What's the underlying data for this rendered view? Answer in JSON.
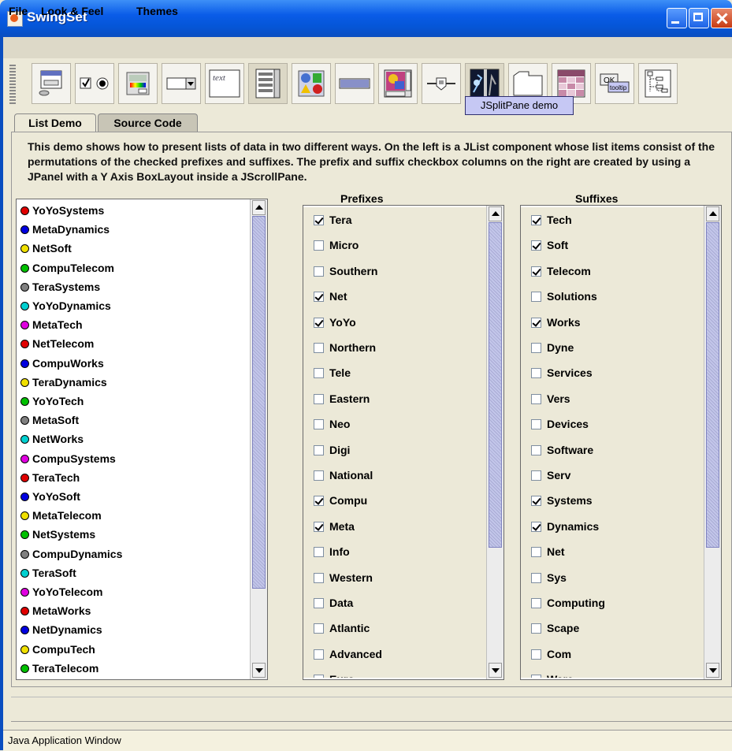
{
  "window": {
    "title": "SwingSet",
    "status_text": "Java Application Window"
  },
  "menubar": {
    "items": [
      {
        "label": "File"
      },
      {
        "label": "Look & Feel"
      },
      {
        "label": "Themes"
      }
    ]
  },
  "toolbar": {
    "buttons": [
      {
        "icon": "internal-frame-icon"
      },
      {
        "icon": "checkbox-radio-icon"
      },
      {
        "icon": "color-chooser-icon"
      },
      {
        "icon": "combobox-icon"
      },
      {
        "icon": "editor-pane-icon",
        "text": "text"
      },
      {
        "icon": "list-icon"
      },
      {
        "icon": "option-pane-icon"
      },
      {
        "icon": "progress-bar-icon"
      },
      {
        "icon": "scroll-pane-icon"
      },
      {
        "icon": "slider-icon"
      },
      {
        "icon": "split-pane-icon"
      },
      {
        "icon": "tabbed-pane-icon"
      },
      {
        "icon": "table-icon"
      },
      {
        "icon": "tooltip-icon",
        "text_ok": "OK",
        "text_tip": "tooltip"
      },
      {
        "icon": "tree-icon"
      }
    ],
    "tooltip": "JSplitPane demo"
  },
  "tabs": [
    {
      "label": "List Demo"
    },
    {
      "label": "Source Code"
    }
  ],
  "description": "This demo shows how to present lists of data in two different ways. On the left is a JList component whose list items consist of the permutations of the checked prefixes and suffixes. The prefix and suffix checkbox columns on the right are created by using a JPanel with a Y Axis BoxLayout inside a JScrollPane.",
  "prefixes_header": "Prefixes",
  "suffixes_header": "Suffixes",
  "list": [
    {
      "label": "YoYoSystems",
      "color": "#e00000"
    },
    {
      "label": "MetaDynamics",
      "color": "#0000e0"
    },
    {
      "label": "NetSoft",
      "color": "#f0e000"
    },
    {
      "label": "CompuTelecom",
      "color": "#00c000"
    },
    {
      "label": "TeraSystems",
      "color": "#808080"
    },
    {
      "label": "YoYoDynamics",
      "color": "#00d0d0"
    },
    {
      "label": "MetaTech",
      "color": "#e000e0"
    },
    {
      "label": "NetTelecom",
      "color": "#e00000"
    },
    {
      "label": "CompuWorks",
      "color": "#0000e0"
    },
    {
      "label": "TeraDynamics",
      "color": "#f0e000"
    },
    {
      "label": "YoYoTech",
      "color": "#00c000"
    },
    {
      "label": "MetaSoft",
      "color": "#808080"
    },
    {
      "label": "NetWorks",
      "color": "#00d0d0"
    },
    {
      "label": "CompuSystems",
      "color": "#e000e0"
    },
    {
      "label": "TeraTech",
      "color": "#e00000"
    },
    {
      "label": "YoYoSoft",
      "color": "#0000e0"
    },
    {
      "label": "MetaTelecom",
      "color": "#f0e000"
    },
    {
      "label": "NetSystems",
      "color": "#00c000"
    },
    {
      "label": "CompuDynamics",
      "color": "#808080"
    },
    {
      "label": "TeraSoft",
      "color": "#00d0d0"
    },
    {
      "label": "YoYoTelecom",
      "color": "#e000e0"
    },
    {
      "label": "MetaWorks",
      "color": "#e00000"
    },
    {
      "label": "NetDynamics",
      "color": "#0000e0"
    },
    {
      "label": "CompuTech",
      "color": "#f0e000"
    },
    {
      "label": "TeraTelecom",
      "color": "#00c000"
    }
  ],
  "prefixes": [
    {
      "label": "Tera",
      "checked": true
    },
    {
      "label": "Micro",
      "checked": false
    },
    {
      "label": "Southern",
      "checked": false
    },
    {
      "label": "Net",
      "checked": true
    },
    {
      "label": "YoYo",
      "checked": true
    },
    {
      "label": "Northern",
      "checked": false
    },
    {
      "label": "Tele",
      "checked": false
    },
    {
      "label": "Eastern",
      "checked": false
    },
    {
      "label": "Neo",
      "checked": false
    },
    {
      "label": "Digi",
      "checked": false
    },
    {
      "label": "National",
      "checked": false
    },
    {
      "label": "Compu",
      "checked": true
    },
    {
      "label": "Meta",
      "checked": true
    },
    {
      "label": "Info",
      "checked": false
    },
    {
      "label": "Western",
      "checked": false
    },
    {
      "label": "Data",
      "checked": false
    },
    {
      "label": "Atlantic",
      "checked": false
    },
    {
      "label": "Advanced",
      "checked": false
    },
    {
      "label": "Euro",
      "checked": false
    }
  ],
  "suffixes": [
    {
      "label": "Tech",
      "checked": true
    },
    {
      "label": "Soft",
      "checked": true
    },
    {
      "label": "Telecom",
      "checked": true
    },
    {
      "label": "Solutions",
      "checked": false
    },
    {
      "label": "Works",
      "checked": true
    },
    {
      "label": "Dyne",
      "checked": false
    },
    {
      "label": "Services",
      "checked": false
    },
    {
      "label": "Vers",
      "checked": false
    },
    {
      "label": "Devices",
      "checked": false
    },
    {
      "label": "Software",
      "checked": false
    },
    {
      "label": "Serv",
      "checked": false
    },
    {
      "label": "Systems",
      "checked": true
    },
    {
      "label": "Dynamics",
      "checked": true
    },
    {
      "label": "Net",
      "checked": false
    },
    {
      "label": "Sys",
      "checked": false
    },
    {
      "label": "Computing",
      "checked": false
    },
    {
      "label": "Scape",
      "checked": false
    },
    {
      "label": "Com",
      "checked": false
    },
    {
      "label": "Ware",
      "checked": false
    }
  ]
}
